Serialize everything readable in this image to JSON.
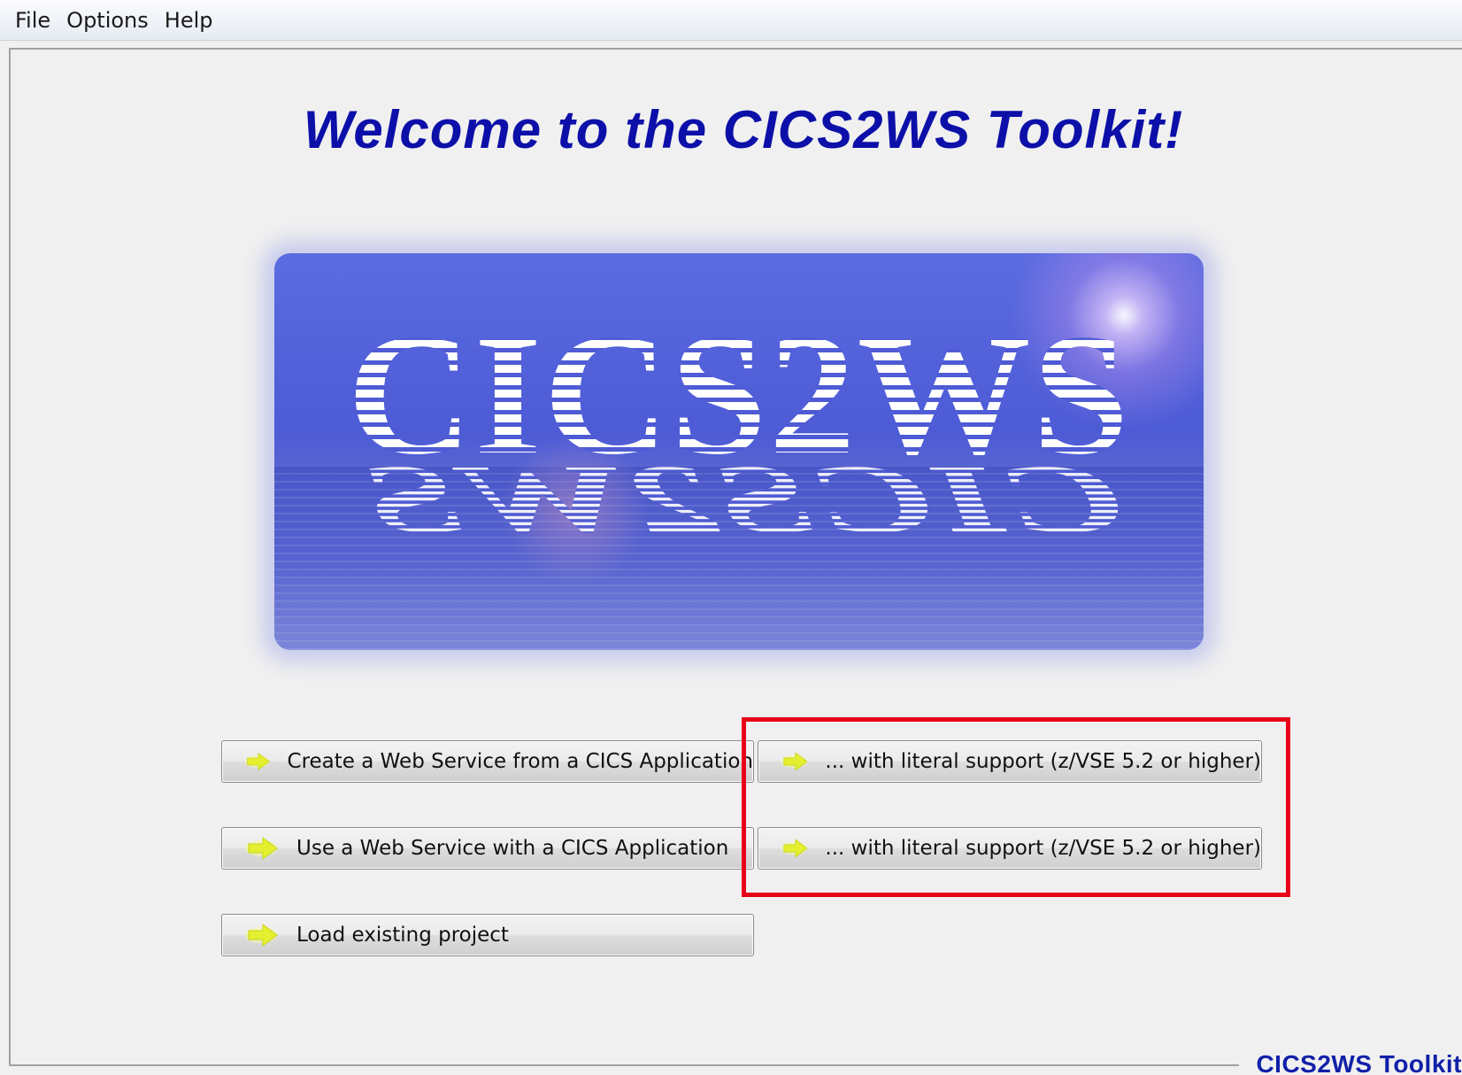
{
  "menu": {
    "file": "File",
    "options": "Options",
    "help": "Help"
  },
  "main": {
    "title": "Welcome to the CICS2WS Toolkit!",
    "logo_text": "CICS2WS",
    "logo_reflection": "CICS2WS"
  },
  "buttons": {
    "create_ws": "Create a Web Service from a CICS Application",
    "create_ws_literal": "... with literal support (z/VSE 5.2 or higher)",
    "use_ws": "Use a Web Service with a CICS Application",
    "use_ws_literal": "... with literal support (z/VSE 5.2 or higher)",
    "load_project": "Load existing project"
  },
  "footer": {
    "label": "CICS2WS Toolkit"
  },
  "colors": {
    "title": "#0c10a8",
    "highlight": "#e8001a",
    "arrow": "#e6f23a"
  },
  "icons": {
    "button_arrow": "arrow-right-icon"
  }
}
